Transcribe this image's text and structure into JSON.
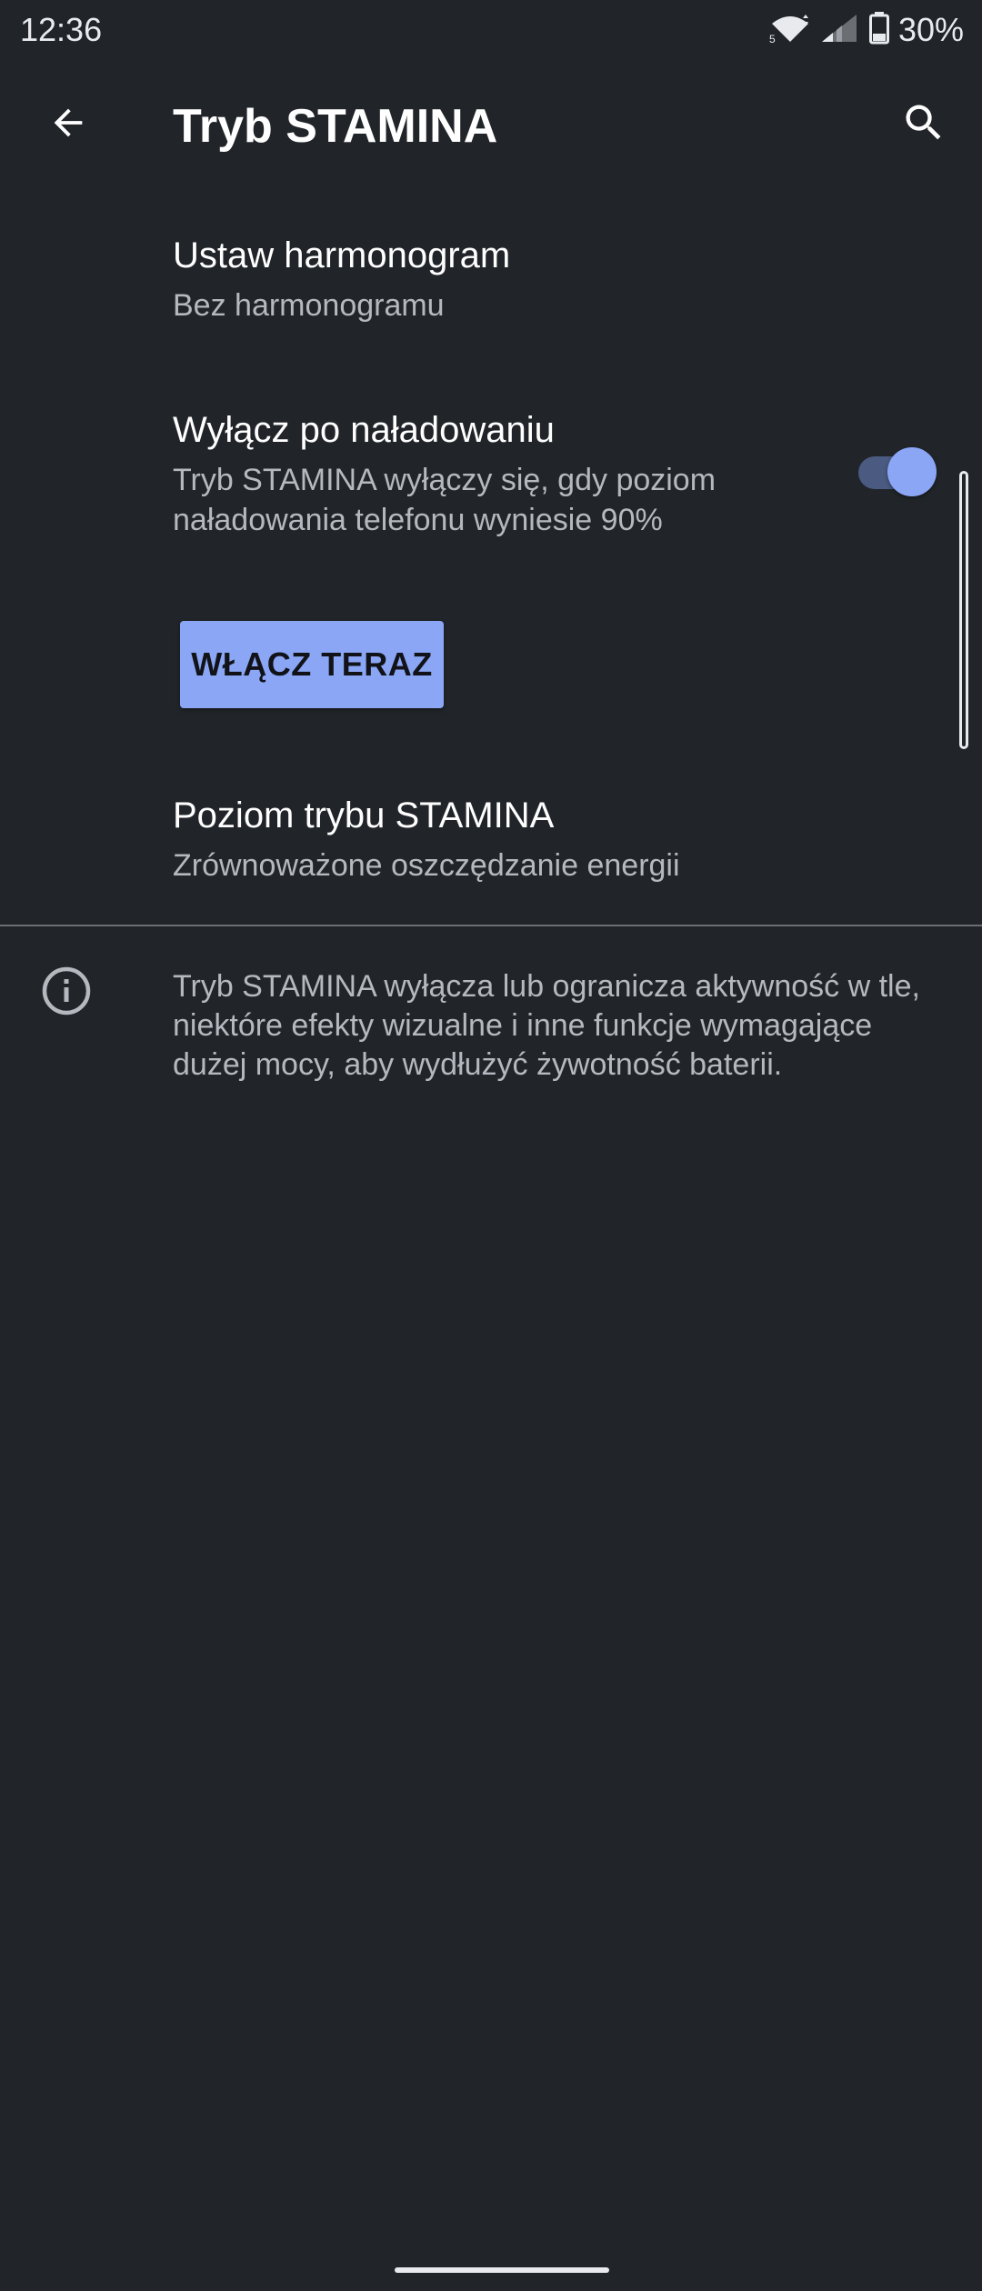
{
  "status_bar": {
    "time": "12:36",
    "battery_percent": "30%",
    "icons": [
      "wifi-5-icon",
      "signal-icon",
      "battery-icon"
    ]
  },
  "app_bar": {
    "title": "Tryb STAMINA",
    "back_icon": "arrow-back-icon",
    "search_icon": "search-icon"
  },
  "settings": {
    "schedule": {
      "title": "Ustaw harmonogram",
      "subtitle": "Bez harmonogramu"
    },
    "turn_off_when_charged": {
      "title": "Wyłącz po naładowaniu",
      "subtitle_line1": "Tryb STAMINA wyłączy się, gdy poziom",
      "subtitle_line2": "naładowania telefonu wyniesie 90%",
      "enabled": true
    },
    "enable_now_button": "WŁĄCZ TERAZ",
    "level": {
      "title": "Poziom trybu STAMINA",
      "subtitle": "Zrównoważone oszczędzanie energii"
    }
  },
  "info": {
    "icon": "info-icon",
    "text": "Tryb STAMINA wyłącza lub ogranicza aktywność w tle, niektóre efekty wizualne i inne funkcje wymagające dużej mocy, aby wydłużyć żywotność baterii."
  },
  "colors": {
    "background": "#212529",
    "accent": "#8aa6f5",
    "secondary_text": "#b5b9bf"
  }
}
